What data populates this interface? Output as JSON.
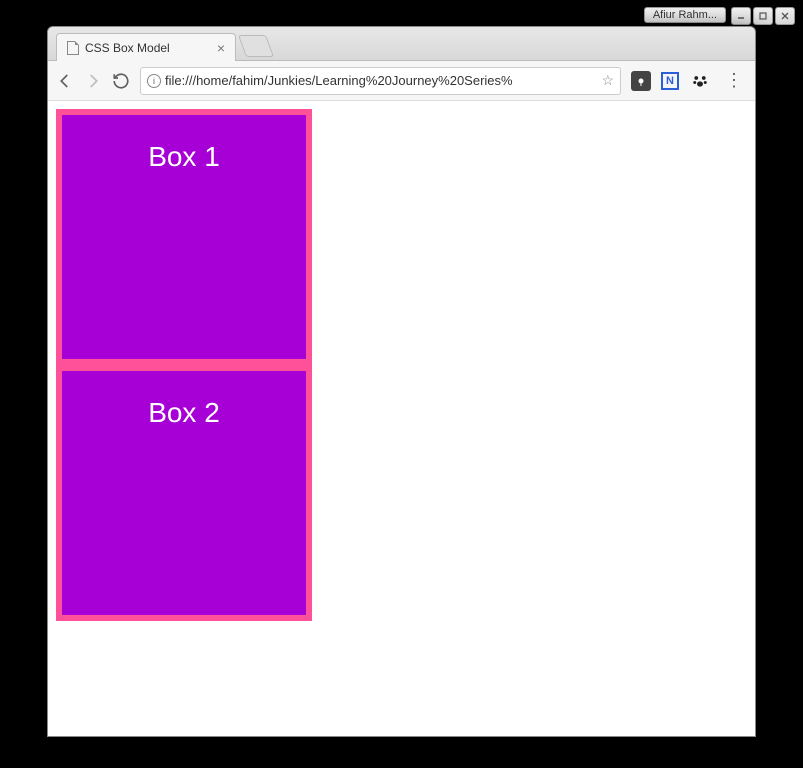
{
  "window": {
    "user_label": "Afiur Rahm..."
  },
  "tab": {
    "title": "CSS Box Model"
  },
  "toolbar": {
    "url": "file:///home/fahim/Junkies/Learning%20Journey%20Series%"
  },
  "page": {
    "boxes": [
      {
        "label": "Box 1"
      },
      {
        "label": "Box 2"
      }
    ]
  }
}
